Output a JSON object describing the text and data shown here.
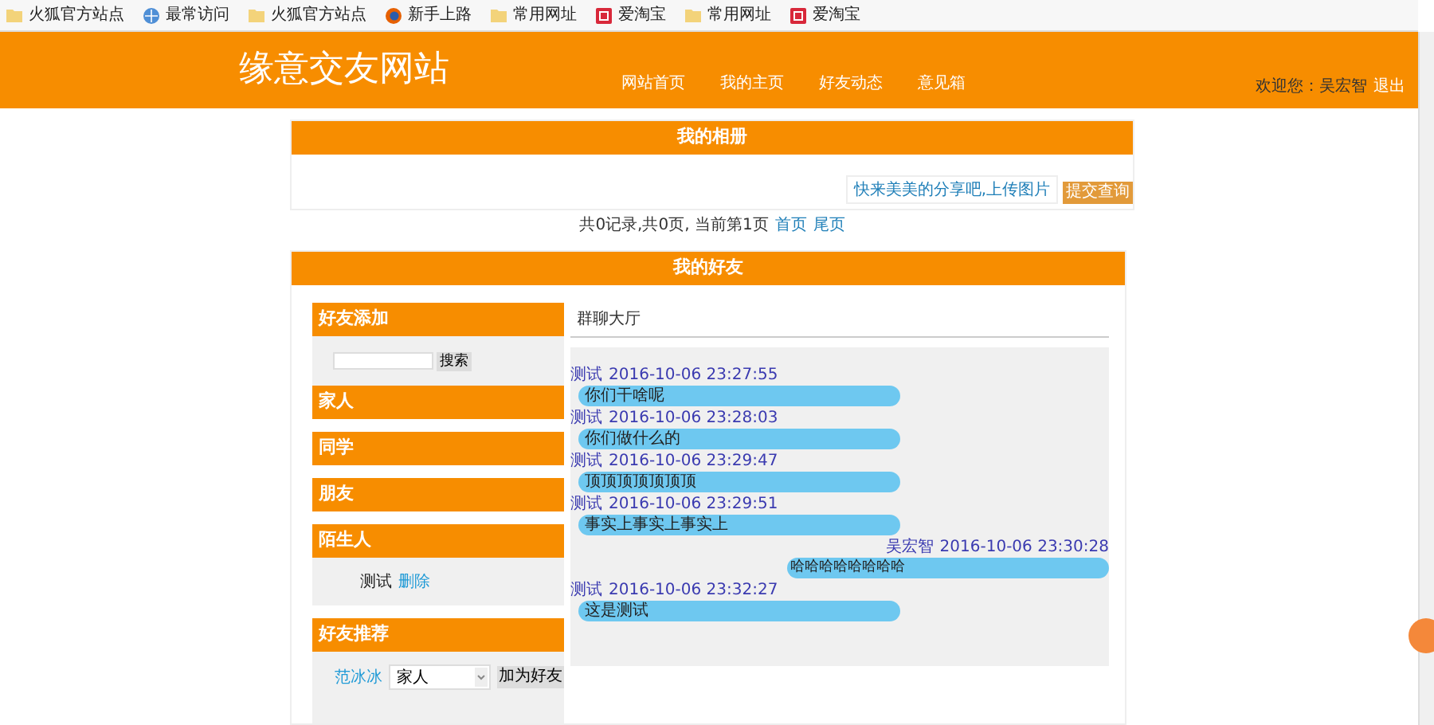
{
  "bookmarks": [
    {
      "label": "火狐官方站点",
      "kind": "folder"
    },
    {
      "label": "最常访问",
      "kind": "globe"
    },
    {
      "label": "火狐官方站点",
      "kind": "folder"
    },
    {
      "label": "新手上路",
      "kind": "firefox"
    },
    {
      "label": "常用网址",
      "kind": "folder"
    },
    {
      "label": "爱淘宝",
      "kind": "taobao"
    },
    {
      "label": "常用网址",
      "kind": "folder"
    },
    {
      "label": "爱淘宝",
      "kind": "taobao"
    }
  ],
  "header": {
    "title": "缘意交友网站",
    "nav": [
      "网站首页",
      "我的主页",
      "好友动态",
      "意见箱"
    ],
    "welcome": "欢迎您：吴宏智",
    "logout": "退出"
  },
  "album": {
    "title": "我的相册",
    "upload_button": "快来美美的分享吧,上传图片",
    "submit_button": "提交查询",
    "pagination": {
      "text": "共0记录,共0页, 当前第1页",
      "links": [
        "首页",
        "尾页"
      ]
    }
  },
  "friends": {
    "title": "我的好友",
    "add": {
      "title": "好友添加",
      "search_button": "搜索"
    },
    "groups": [
      {
        "title": "家人"
      },
      {
        "title": "同学"
      },
      {
        "title": "朋友"
      },
      {
        "title": "陌生人",
        "members": [
          {
            "name": "测试",
            "action": "删除"
          }
        ]
      }
    ],
    "recommend": {
      "title": "好友推荐",
      "rows": [
        {
          "name": "范冰冰",
          "group": "家人",
          "button": "加为好友"
        }
      ]
    },
    "chat": {
      "title": "群聊大厅",
      "messages": [
        {
          "sender": "测试",
          "time": "2016-10-06 23:27:55",
          "text": "你们干啥呢",
          "mine": false
        },
        {
          "sender": "测试",
          "time": "2016-10-06 23:28:03",
          "text": "你们做什么的",
          "mine": false
        },
        {
          "sender": "测试",
          "time": "2016-10-06 23:29:47",
          "text": "顶顶顶顶顶顶顶",
          "mine": false
        },
        {
          "sender": "测试",
          "time": "2016-10-06 23:29:51",
          "text": "事实上事实上事实上",
          "mine": false
        },
        {
          "sender": "吴宏智",
          "time": "2016-10-06 23:30:28",
          "text": "哈哈哈哈哈哈哈哈",
          "mine": true
        },
        {
          "sender": "测试",
          "time": "2016-10-06 23:32:27",
          "text": "这是测试",
          "mine": false
        }
      ]
    }
  }
}
